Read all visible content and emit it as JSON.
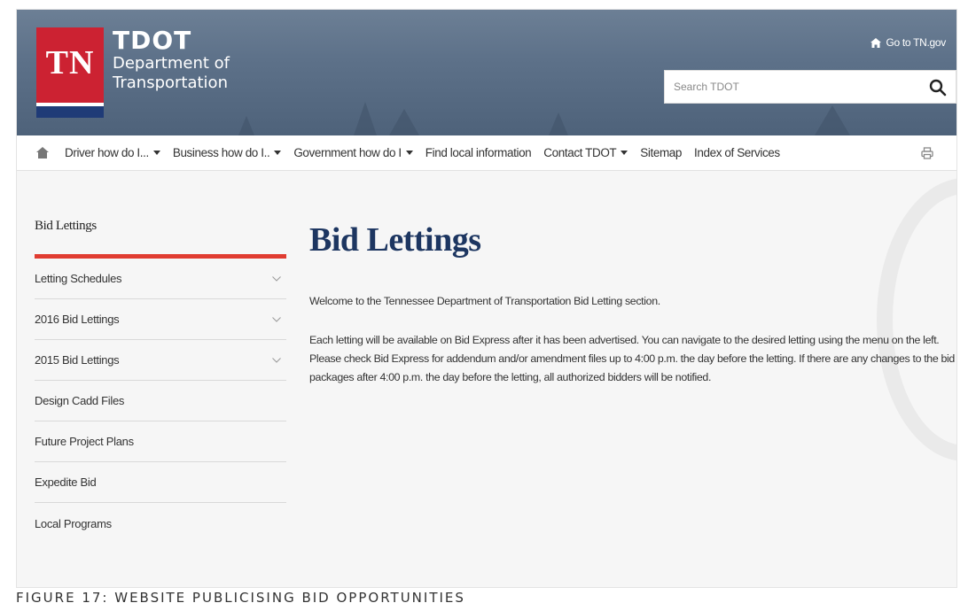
{
  "header": {
    "logo": {
      "badge": "TN",
      "abbr": "TDOT",
      "line1": "Department of",
      "line2": "Transportation"
    },
    "goto_link": "Go to TN.gov",
    "search": {
      "placeholder": "Search TDOT",
      "value": ""
    }
  },
  "nav": {
    "items": [
      {
        "label": "Driver how do I...",
        "dropdown": true
      },
      {
        "label": "Business how do I..",
        "dropdown": true
      },
      {
        "label": "Government how do I",
        "dropdown": true
      },
      {
        "label": "Find local information",
        "dropdown": false
      },
      {
        "label": "Contact TDOT",
        "dropdown": true
      },
      {
        "label": "Sitemap",
        "dropdown": false
      },
      {
        "label": "Index of Services",
        "dropdown": false
      }
    ]
  },
  "sidebar": {
    "title": "Bid Lettings",
    "items": [
      {
        "label": "Letting Schedules",
        "expandable": true
      },
      {
        "label": "2016 Bid Lettings",
        "expandable": true
      },
      {
        "label": "2015 Bid Lettings",
        "expandable": true
      },
      {
        "label": "Design Cadd Files",
        "expandable": false
      },
      {
        "label": "Future Project Plans",
        "expandable": false
      },
      {
        "label": "Expedite Bid",
        "expandable": false
      },
      {
        "label": "Local Programs",
        "expandable": false
      }
    ]
  },
  "main": {
    "title": "Bid Lettings",
    "intro": "Welcome to the Tennessee Department of  Transportation Bid Letting section.",
    "body": "Each letting will be available on Bid Express after it has been advertised. You can navigate to the desired letting using the menu on the left. Please check Bid Express for addendum and/or amendment files up to 4:00 p.m. the day before the letting. If there are any changes to the bid packages after 4:00 p.m. the day before the letting, all authorized bidders will be notified."
  },
  "caption": "FIGURE 17: WEBSITE PUBLICISING BID OPPORTUNITIES",
  "colors": {
    "brand_red": "#cc2232",
    "brand_blue": "#1f3b77",
    "title_navy": "#1d3661",
    "accent_bar": "#e03c31"
  }
}
